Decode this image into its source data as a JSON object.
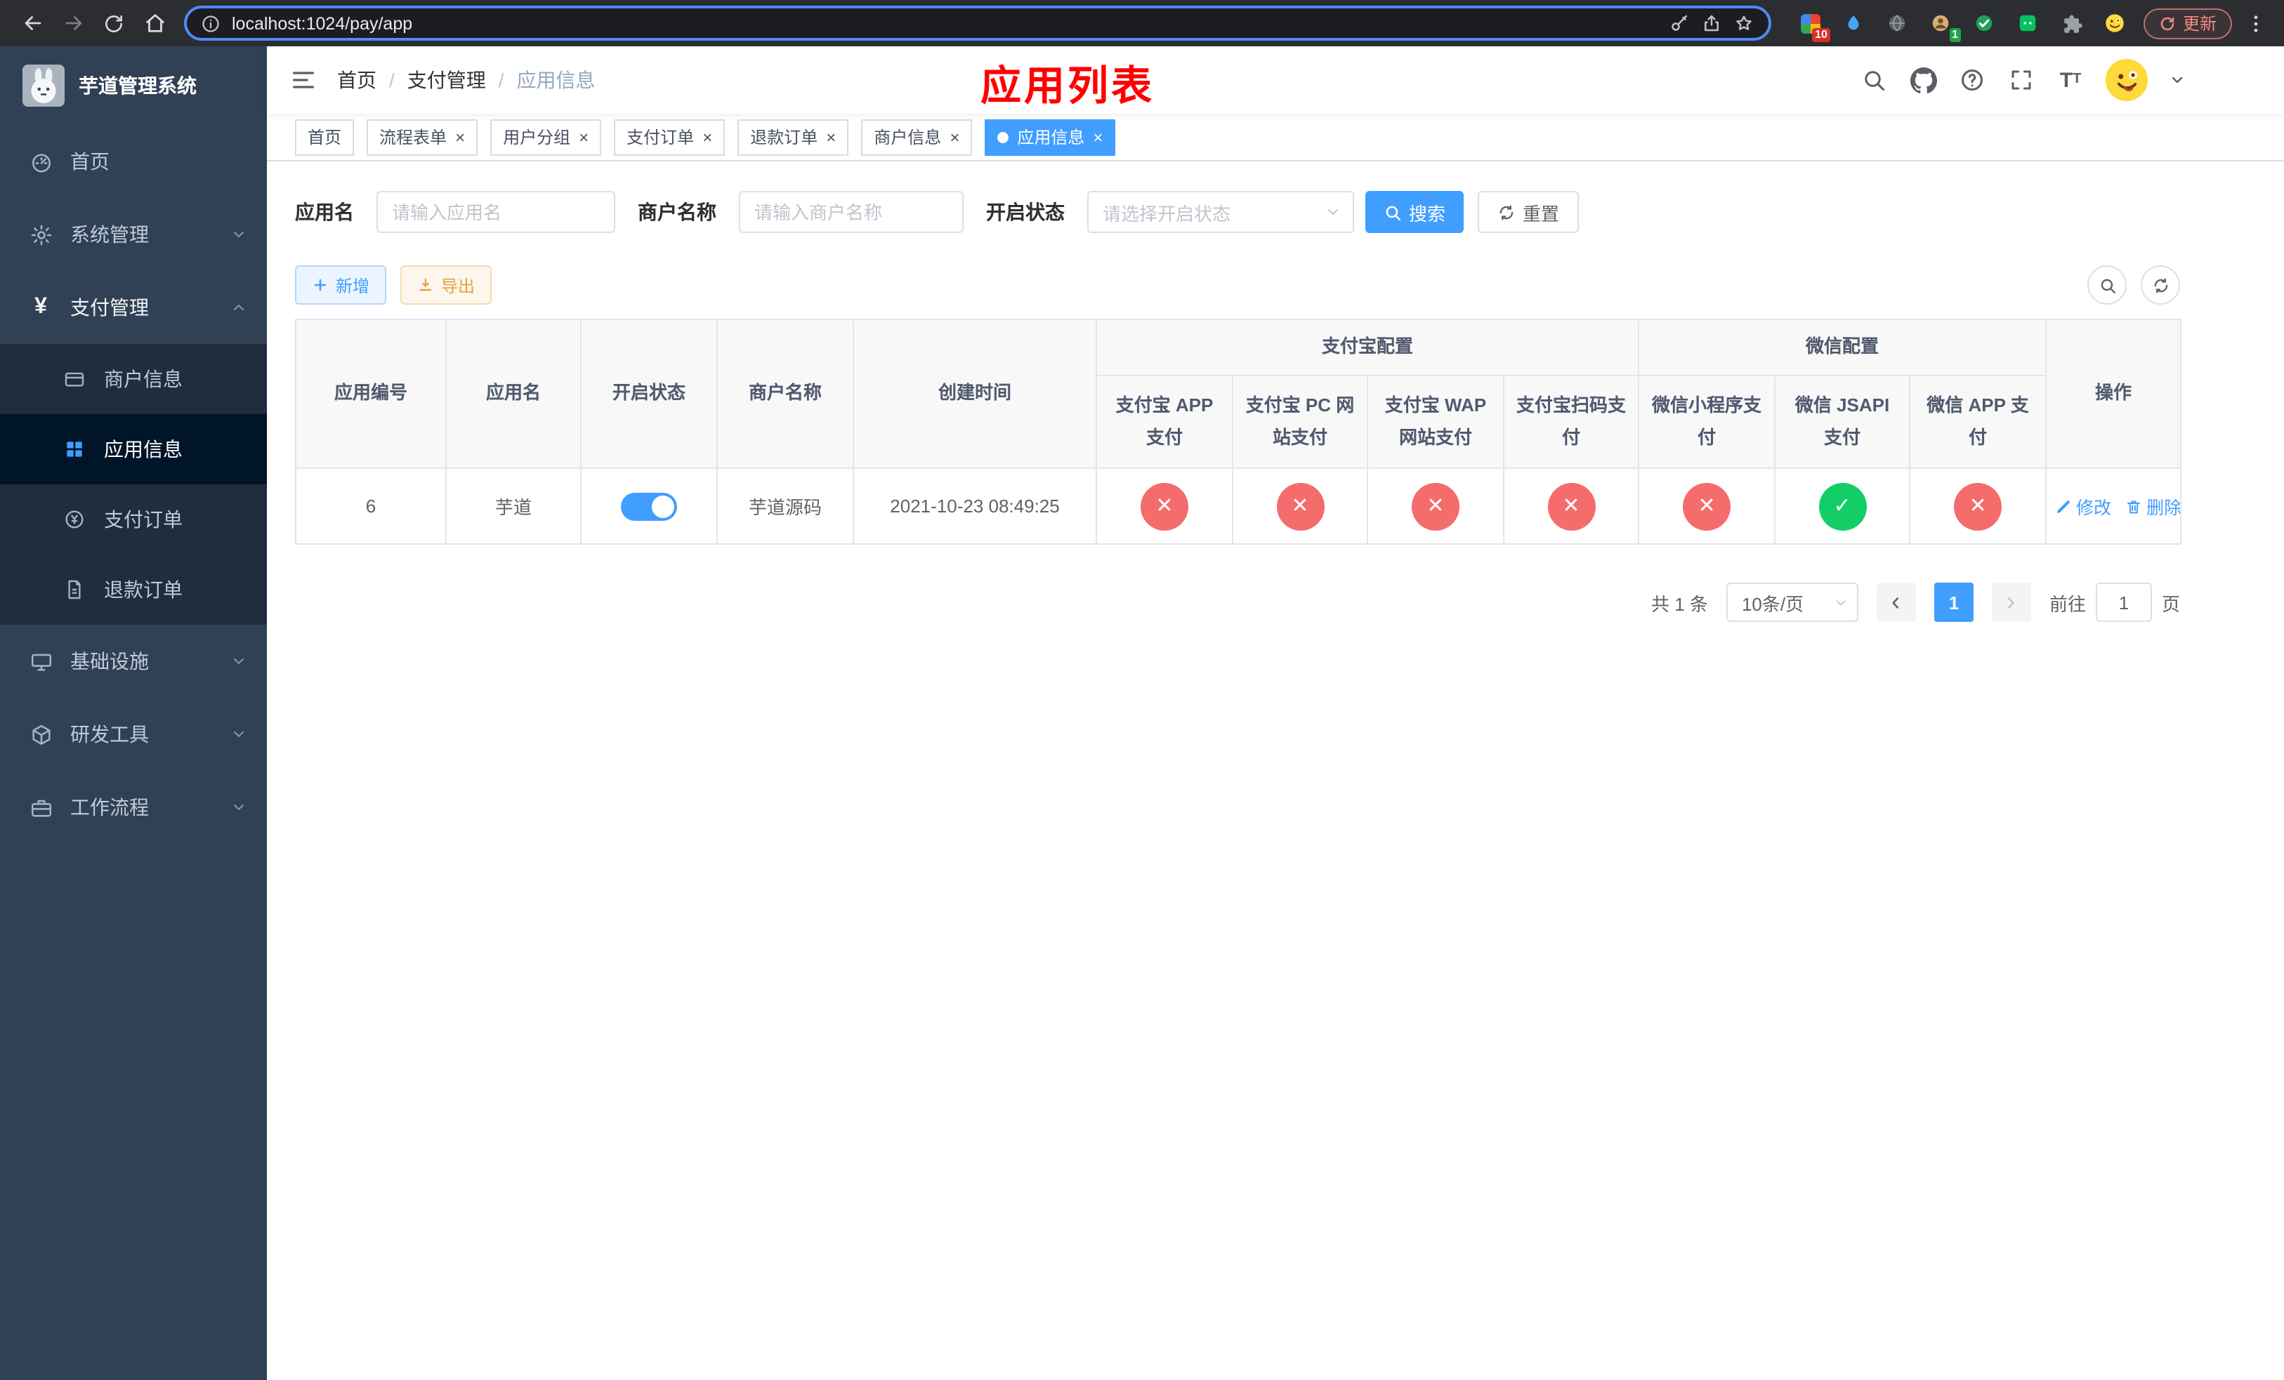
{
  "colors": {
    "accent": "#409eff",
    "success": "#13ce66",
    "danger": "#f56c6c",
    "warning": "#e6a23c",
    "annotation_red": "#ff0000",
    "sidebar_bg": "#304156"
  },
  "browser": {
    "url": "localhost:1024/pay/app",
    "update_label": "更新",
    "extension_badges": {
      "first": "10",
      "second": "1"
    }
  },
  "sidebar": {
    "logo_title": "芋道管理系统",
    "menu": [
      {
        "label": "首页"
      },
      {
        "label": "系统管理"
      },
      {
        "label": "支付管理"
      },
      {
        "label": "基础设施"
      },
      {
        "label": "研发工具"
      },
      {
        "label": "工作流程"
      }
    ],
    "pay_submenu": [
      {
        "label": "商户信息"
      },
      {
        "label": "应用信息"
      },
      {
        "label": "支付订单"
      },
      {
        "label": "退款订单"
      }
    ]
  },
  "header": {
    "breadcrumb": [
      "首页",
      "支付管理",
      "应用信息"
    ],
    "annotation": "应用列表"
  },
  "tabs": [
    {
      "label": "首页"
    },
    {
      "label": "流程表单"
    },
    {
      "label": "用户分组"
    },
    {
      "label": "支付订单"
    },
    {
      "label": "退款订单"
    },
    {
      "label": "商户信息"
    },
    {
      "label": "应用信息"
    }
  ],
  "filters": {
    "app_name_label": "应用名",
    "app_name_placeholder": "请输入应用名",
    "merchant_label": "商户名称",
    "merchant_placeholder": "请输入商户名称",
    "status_label": "开启状态",
    "status_placeholder": "请选择开启状态",
    "search_label": "搜索",
    "reset_label": "重置"
  },
  "toolbar": {
    "add_label": "新增",
    "export_label": "导出"
  },
  "table": {
    "group_headers": {
      "alipay": "支付宝配置",
      "wechat": "微信配置"
    },
    "headers": {
      "app_id": "应用编号",
      "app_name": "应用名",
      "status": "开启状态",
      "merchant": "商户名称",
      "created": "创建时间",
      "alipay_app": "支付宝 APP 支付",
      "alipay_pc": "支付宝 PC 网站支付",
      "alipay_wap": "支付宝 WAP 网站支付",
      "alipay_qr": "支付宝扫码支付",
      "wx_lite": "微信小程序支付",
      "wx_jsapi": "微信 JSAPI 支付",
      "wx_app": "微信 APP 支付",
      "actions": "操作"
    },
    "rows": [
      {
        "app_id": "6",
        "app_name": "芋道",
        "enabled": true,
        "merchant": "芋道源码",
        "created": "2021-10-23 08:49:25",
        "alipay_app": false,
        "alipay_pc": false,
        "alipay_wap": false,
        "alipay_qr": false,
        "wx_lite": false,
        "wx_jsapi": true,
        "wx_app": false,
        "edit_label": "修改",
        "delete_label": "删除"
      }
    ]
  },
  "pagination": {
    "total_text": "共 1 条",
    "page_size_label": "10条/页",
    "current_page": "1",
    "goto_prefix": "前往",
    "goto_value": "1",
    "goto_suffix": "页"
  }
}
